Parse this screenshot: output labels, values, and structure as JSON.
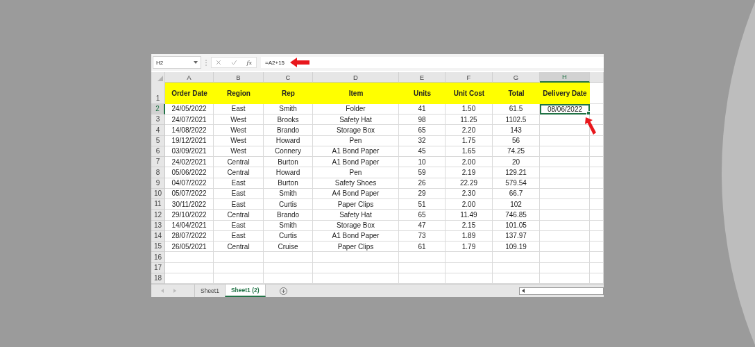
{
  "formula_bar": {
    "name_box": "H2",
    "function_label": "fx",
    "formula": "=A2+15"
  },
  "columns": [
    {
      "label": "A",
      "selected": false
    },
    {
      "label": "B",
      "selected": false
    },
    {
      "label": "C",
      "selected": false
    },
    {
      "label": "D",
      "selected": false
    },
    {
      "label": "E",
      "selected": false
    },
    {
      "label": "F",
      "selected": false
    },
    {
      "label": "G",
      "selected": false
    },
    {
      "label": "H",
      "selected": true
    }
  ],
  "header_row": {
    "number": "1",
    "cells": [
      "Order Date",
      "Region",
      "Rep",
      "Item",
      "Units",
      "Unit Cost",
      "Total",
      "Delivery Date"
    ]
  },
  "rows": [
    {
      "number": "2",
      "selected": true,
      "cells": [
        "24/05/2022",
        "East",
        "Smith",
        "Folder",
        "41",
        "1.50",
        "61.5",
        "08/06/2022"
      ]
    },
    {
      "number": "3",
      "selected": false,
      "cells": [
        "24/07/2021",
        "West",
        "Brooks",
        "Safety Hat",
        "98",
        "11.25",
        "1102.5",
        ""
      ]
    },
    {
      "number": "4",
      "selected": false,
      "cells": [
        "14/08/2022",
        "West",
        "Brando",
        "Storage Box",
        "65",
        "2.20",
        "143",
        ""
      ]
    },
    {
      "number": "5",
      "selected": false,
      "cells": [
        "19/12/2021",
        "West",
        "Howard",
        "Pen",
        "32",
        "1.75",
        "56",
        ""
      ]
    },
    {
      "number": "6",
      "selected": false,
      "cells": [
        "03/09/2021",
        "West",
        "Connery",
        "A1 Bond Paper",
        "45",
        "1.65",
        "74.25",
        ""
      ]
    },
    {
      "number": "7",
      "selected": false,
      "cells": [
        "24/02/2021",
        "Central",
        "Burton",
        "A1 Bond Paper",
        "10",
        "2.00",
        "20",
        ""
      ]
    },
    {
      "number": "8",
      "selected": false,
      "cells": [
        "05/06/2022",
        "Central",
        "Howard",
        "Pen",
        "59",
        "2.19",
        "129.21",
        ""
      ]
    },
    {
      "number": "9",
      "selected": false,
      "cells": [
        "04/07/2022",
        "East",
        "Burton",
        "Safety Shoes",
        "26",
        "22.29",
        "579.54",
        ""
      ]
    },
    {
      "number": "10",
      "selected": false,
      "cells": [
        "05/07/2022",
        "East",
        "Smith",
        "A4 Bond Paper",
        "29",
        "2.30",
        "66.7",
        ""
      ]
    },
    {
      "number": "11",
      "selected": false,
      "cells": [
        "30/11/2022",
        "East",
        "Curtis",
        "Paper Clips",
        "51",
        "2.00",
        "102",
        ""
      ]
    },
    {
      "number": "12",
      "selected": false,
      "cells": [
        "29/10/2022",
        "Central",
        "Brando",
        "Safety Hat",
        "65",
        "11.49",
        "746.85",
        ""
      ]
    },
    {
      "number": "13",
      "selected": false,
      "cells": [
        "14/04/2021",
        "East",
        "Smith",
        "Storage Box",
        "47",
        "2.15",
        "101.05",
        ""
      ]
    },
    {
      "number": "14",
      "selected": false,
      "cells": [
        "28/07/2022",
        "East",
        "Curtis",
        "A1 Bond Paper",
        "73",
        "1.89",
        "137.97",
        ""
      ]
    },
    {
      "number": "15",
      "selected": false,
      "cells": [
        "26/05/2021",
        "Central",
        "Cruise",
        "Paper Clips",
        "61",
        "1.79",
        "109.19",
        ""
      ]
    },
    {
      "number": "16",
      "selected": false,
      "cells": [
        "",
        "",
        "",
        "",
        "",
        "",
        "",
        ""
      ]
    },
    {
      "number": "17",
      "selected": false,
      "cells": [
        "",
        "",
        "",
        "",
        "",
        "",
        "",
        ""
      ]
    },
    {
      "number": "18",
      "selected": false,
      "cells": [
        "",
        "",
        "",
        "",
        "",
        "",
        "",
        ""
      ]
    }
  ],
  "sheet_tabs": [
    {
      "label": "Sheet1",
      "selected": false
    },
    {
      "label": "Sheet1 (2)",
      "selected": true
    }
  ]
}
